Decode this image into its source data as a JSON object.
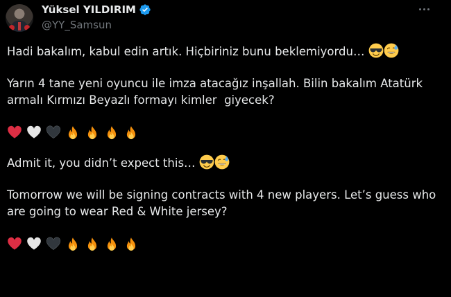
{
  "author": {
    "display_name": "Yüksel YILDIRIM",
    "handle": "@YY_Samsun",
    "verified": true,
    "verified_color": "#1d9bf0"
  },
  "menu": {
    "icon": "more-horizontal-icon"
  },
  "tweet": {
    "p1_text": "Hadi bakalım, kabul edin artık. Hiçbiriniz bunu beklemiyordu…",
    "p1_emojis": [
      "sunglasses-face-icon",
      "sweat-smile-face-icon"
    ],
    "p2_text": "Yarın 4 tane yeni oyuncu ile imza atacağız inşallah. Bilin bakalım Atatürk armalı Kırmızı Beyazlı formayı kimler  giyecek?",
    "p3_emojis": [
      "red-heart-icon",
      "white-heart-icon",
      "black-heart-icon",
      "fire-icon",
      "fire-icon",
      "fire-icon",
      "fire-icon"
    ],
    "p4_text": "Admit it, you didn’t expect this…",
    "p4_emojis": [
      "sunglasses-face-icon",
      "sweat-smile-face-icon"
    ],
    "p5_text": "Tomorrow we will be signing contracts with 4 new players. Let’s guess who are going to wear Red & White jersey?",
    "p6_emojis": [
      "red-heart-icon",
      "white-heart-icon",
      "black-heart-icon",
      "fire-icon",
      "fire-icon",
      "fire-icon",
      "fire-icon"
    ]
  },
  "colors": {
    "background": "#000000",
    "text": "#e7e9ea",
    "secondary": "#71767b",
    "heart_red": "#dd2e44",
    "heart_white": "#e6e6e6",
    "heart_black": "#31373d",
    "fire_outer": "#f4900c",
    "fire_inner": "#ffcc4d",
    "face_yellow": "#ffcc4d"
  }
}
